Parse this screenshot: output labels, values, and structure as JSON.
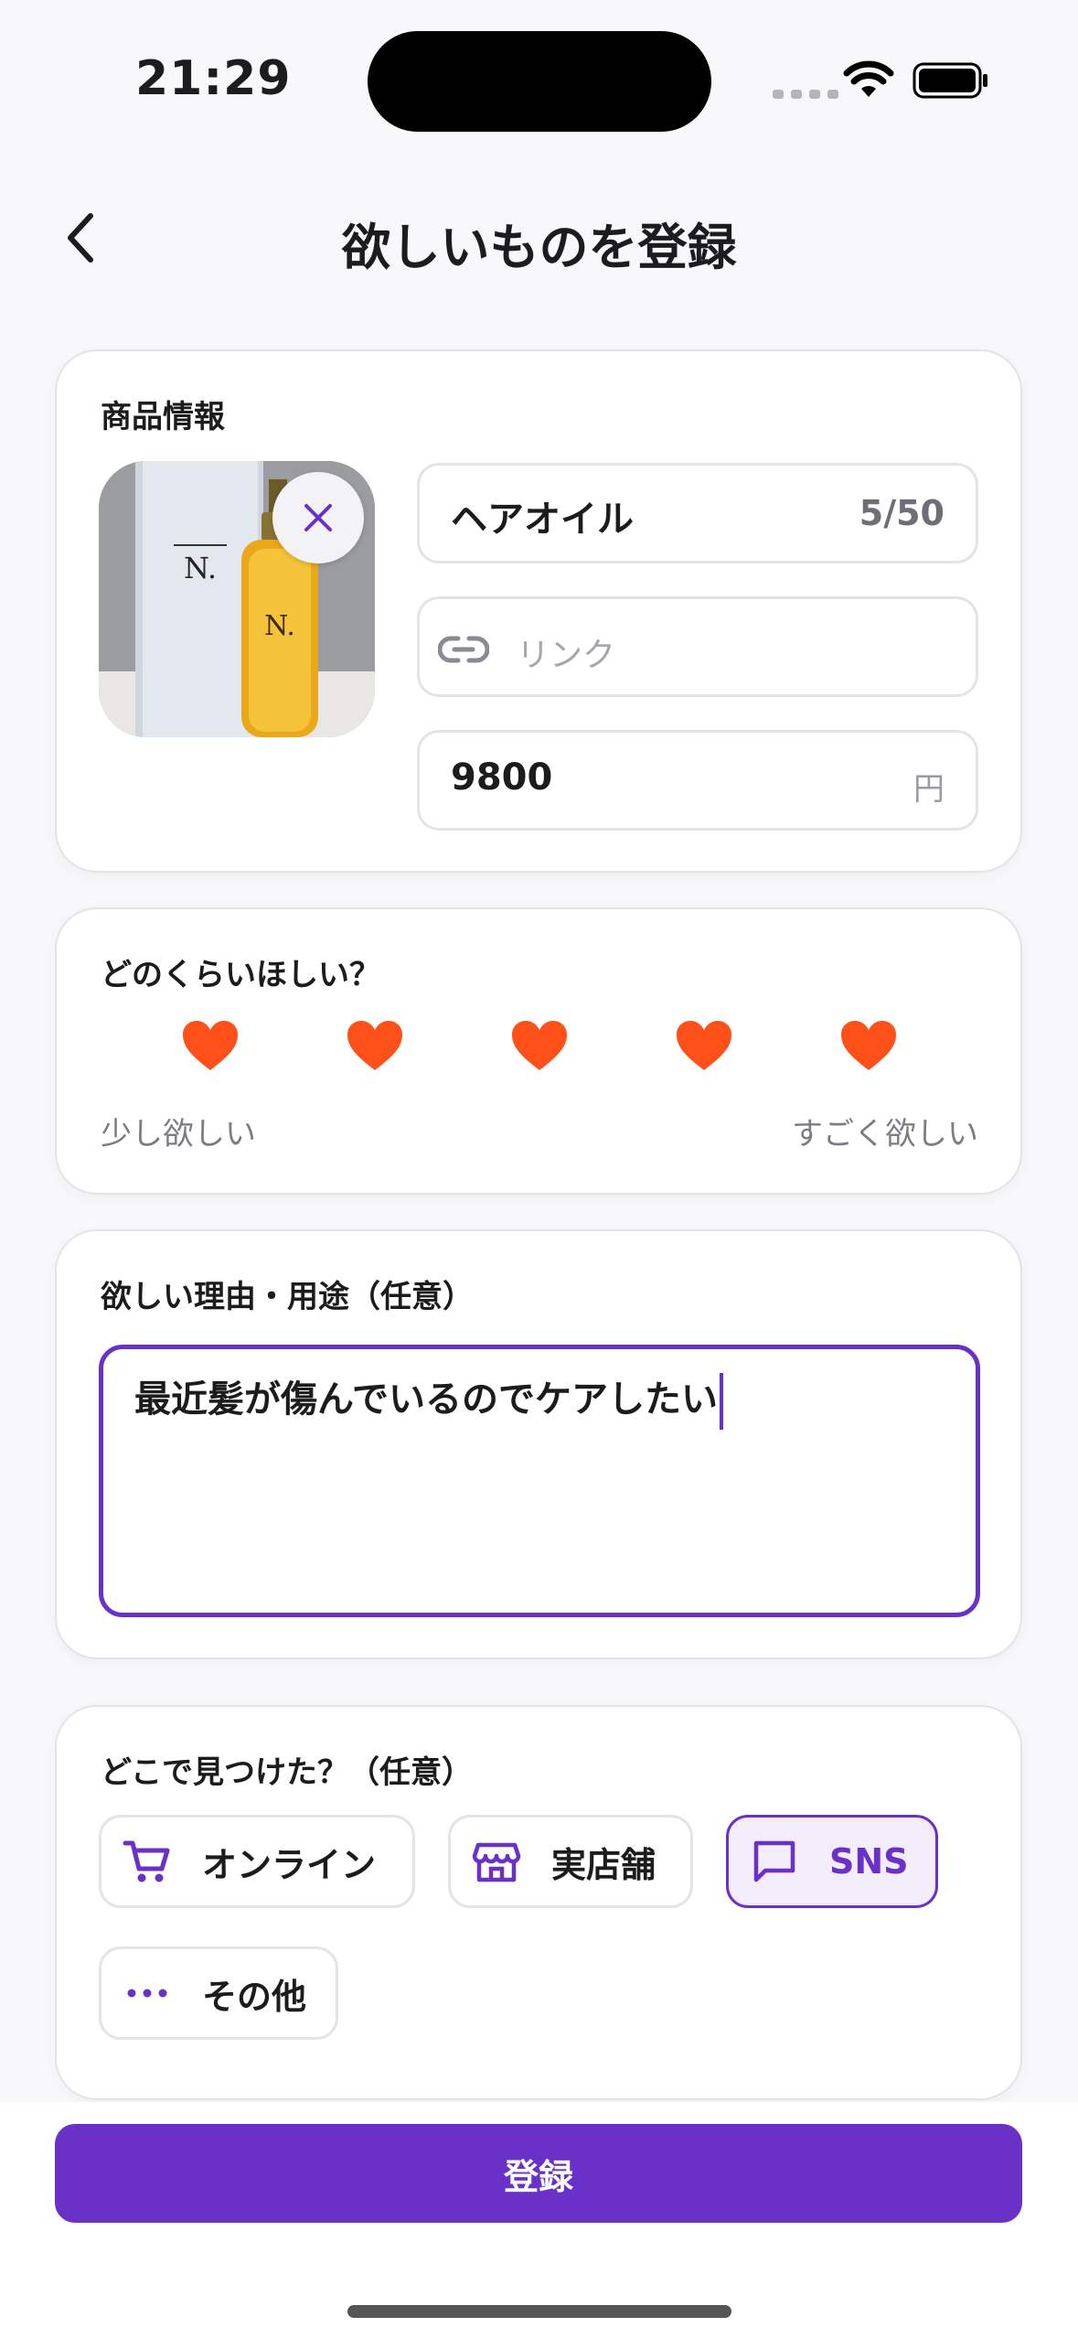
{
  "status_bar": {
    "time": "21:29"
  },
  "nav": {
    "title": "欲しいものを登録"
  },
  "product": {
    "section_label": "商品情報",
    "image_name": "N. SHEA OIL",
    "name_value": "ヘアオイル",
    "name_count": "5/50",
    "link_placeholder": "リンク",
    "price_value": "9800",
    "price_unit": "円"
  },
  "rating": {
    "section_label": "どのくらいほしい？",
    "value": 5,
    "max": 5,
    "heart_color": "#ff5019",
    "low_label": "少し欲しい",
    "high_label": "すごく欲しい"
  },
  "reason": {
    "section_label": "欲しい理由・用途（任意）",
    "value": "最近髪が傷んでいるのでケアしたい"
  },
  "source": {
    "section_label": "どこで見つけた？（任意）",
    "options": [
      {
        "label": "オンライン",
        "icon": "cart-icon",
        "selected": false
      },
      {
        "label": "実店舗",
        "icon": "store-icon",
        "selected": false
      },
      {
        "label": "SNS",
        "icon": "chat-bubble-icon",
        "selected": true
      },
      {
        "label": "その他",
        "icon": "more-icon",
        "selected": false
      }
    ]
  },
  "footer": {
    "submit_label": "登録"
  },
  "colors": {
    "accent": "#6a31c9",
    "heart": "#ff5019",
    "background": "#f8f8fa"
  }
}
